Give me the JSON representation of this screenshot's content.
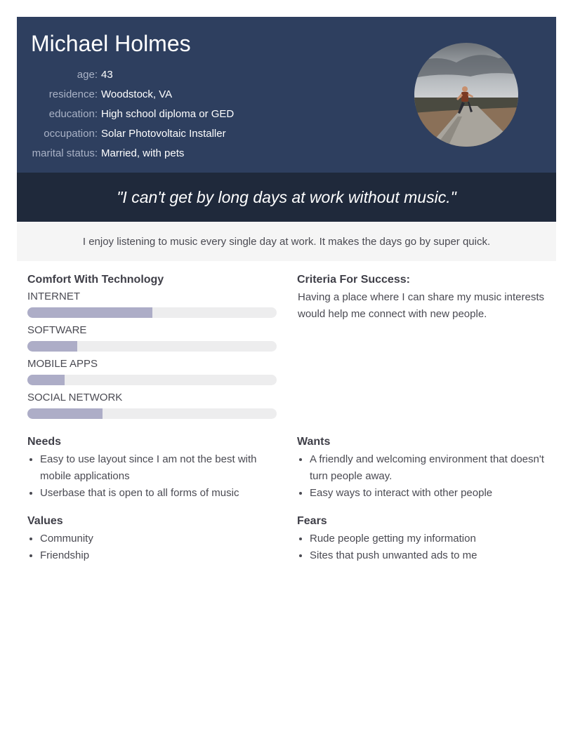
{
  "persona": {
    "name": "Michael Holmes",
    "facts": [
      {
        "label": "age:",
        "value": "43"
      },
      {
        "label": "residence:",
        "value": "Woodstock, VA"
      },
      {
        "label": "education:",
        "value": "High school diploma or GED"
      },
      {
        "label": "occupation:",
        "value": "Solar Photovoltaic Installer"
      },
      {
        "label": "marital status:",
        "value": "Married, with pets"
      }
    ],
    "quote": "\"I can't get by long days at work without music.\"",
    "summary": "I enjoy listening to music every single day at work. It makes the days go by super quick."
  },
  "colors": {
    "header_bg": "#2e3f5f",
    "quote_bg": "#1f293b",
    "bar_fill": "#adadc7",
    "bar_track": "#ededee"
  },
  "technology": {
    "title": "Comfort With Technology",
    "items": [
      {
        "label": "INTERNET",
        "level": 0.5
      },
      {
        "label": "SOFTWARE",
        "level": 0.2
      },
      {
        "label": "MOBILE APPS",
        "level": 0.15
      },
      {
        "label": "SOCIAL NETWORK",
        "level": 0.3
      }
    ]
  },
  "criteria": {
    "title": "Criteria For Success:",
    "text": "Having a place where I can share my music interests would help me connect with new people."
  },
  "needs": {
    "title": "Needs",
    "items": [
      "Easy to use layout since I am not the best with mobile applications",
      "Userbase that is open to all forms of music"
    ]
  },
  "wants": {
    "title": "Wants",
    "items": [
      "A friendly and welcoming environment that doesn't turn people away.",
      "Easy ways to interact with other people"
    ]
  },
  "values": {
    "title": "Values",
    "items": [
      "Community",
      "Friendship"
    ]
  },
  "fears": {
    "title": "Fears",
    "items": [
      "Rude people getting my information",
      "Sites that push unwanted ads to me"
    ]
  }
}
